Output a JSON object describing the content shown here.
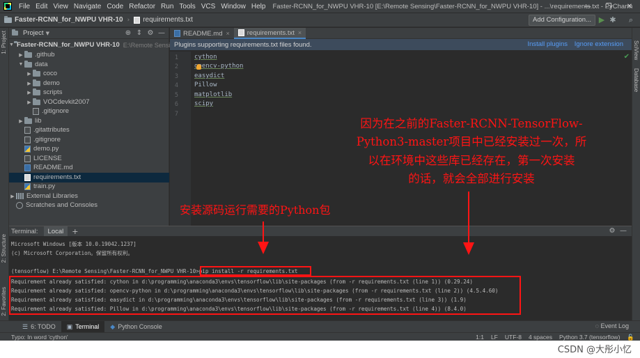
{
  "menubar": {
    "items": [
      "File",
      "Edit",
      "View",
      "Navigate",
      "Code",
      "Refactor",
      "Run",
      "Tools",
      "VCS",
      "Window",
      "Help"
    ],
    "window_title": "Faster-RCNN_for_NWPU VHR-10 [E:\\Remote Sensing\\Faster-RCNN_for_NWPU VHR-10] - ...\\requirements.txt - PyCharm",
    "controls": [
      "—",
      "❐",
      "✕"
    ]
  },
  "navbar": {
    "project": "Faster-RCNN_for_NWPU VHR-10",
    "file": "requirements.txt",
    "add_configuration": "Add Configuration..."
  },
  "left_stripe": {
    "project_tab": "1: Project",
    "structure_tab": "2: Structure",
    "favorites_tab": "2: Favorites"
  },
  "right_stripe": {
    "sciview_tab": "SciView",
    "database_tab": "Database"
  },
  "project_panel": {
    "title": "Project",
    "root": {
      "name": "Faster-RCNN_for_NWPU VHR-10",
      "path": "E:\\Remote Sensi"
    },
    "nodes": [
      {
        "label": ".github"
      },
      {
        "label": "data"
      },
      {
        "label": "coco"
      },
      {
        "label": "demo"
      },
      {
        "label": "scripts"
      },
      {
        "label": "VOCdevkit2007"
      },
      {
        "label": ".gitignore"
      },
      {
        "label": "lib"
      },
      {
        "label": ".gitattributes"
      },
      {
        "label": ".gitignore"
      },
      {
        "label": "demo.py"
      },
      {
        "label": "LICENSE"
      },
      {
        "label": "README.md"
      },
      {
        "label": "requirements.txt"
      },
      {
        "label": "train.py"
      },
      {
        "label": "External Libraries"
      },
      {
        "label": "Scratches and Consoles"
      }
    ]
  },
  "editor": {
    "tabs": [
      {
        "label": "README.md",
        "close": "×"
      },
      {
        "label": "requirements.txt",
        "close": "×"
      }
    ],
    "banner": {
      "message": "Plugins supporting requirements.txt files found.",
      "install": "Install plugins",
      "ignore": "Ignore extension"
    },
    "line_numbers": [
      "1",
      "2",
      "3",
      "4",
      "5",
      "6",
      "7"
    ],
    "lines": [
      "cython",
      "opencv-python",
      "easydict",
      "Pillow",
      "matplotlib",
      "scipy",
      ""
    ]
  },
  "terminal": {
    "label": "Terminal:",
    "tab": "Local",
    "add": "+",
    "lines": [
      "Microsoft Windows [版本 10.0.19042.1237]",
      "(c) Microsoft Corporation。保留所有权利。",
      "",
      "(tensorflow) E:\\Remote Sensing\\Faster-RCNN_for_NWPU VHR-10>pip install -r requirements.txt",
      "Requirement already satisfied: cython in d:\\programming\\anaconda3\\envs\\tensorflow\\lib\\site-packages (from -r requirements.txt (line 1)) (0.29.24)",
      "Requirement already satisfied: opencv-python in d:\\programming\\anaconda3\\envs\\tensorflow\\lib\\site-packages (from -r requirements.txt (line 2)) (4.5.4.60)",
      "Requirement already satisfied: easydict in d:\\programming\\anaconda3\\envs\\tensorflow\\lib\\site-packages (from -r requirements.txt (line 3)) (1.9)",
      "Requirement already satisfied: Pillow in d:\\programming\\anaconda3\\envs\\tensorflow\\lib\\site-packages (from -r requirements.txt (line 4)) (8.4.0)"
    ]
  },
  "bottom_tabs": [
    {
      "label": "6: TODO"
    },
    {
      "label": "Terminal"
    },
    {
      "label": "Python Console"
    }
  ],
  "event_log": "Event Log",
  "status": {
    "message": "Typo: In word 'cython'",
    "position": "1:1",
    "line_sep": "LF",
    "encoding": "UTF-8",
    "indent": "4 spaces",
    "interpreter": "Python 3.7 (tensorflow)"
  },
  "annotations": {
    "install_note": "安装源码运行需要的Python包",
    "explanation_lines": [
      "因为在之前的Faster-RCNN-TensorFlow-",
      "Python3-master项目中已经安装过一次，所",
      "以在环境中这些库已经存在，第一次安装",
      "的话，就会全部进行安装"
    ]
  },
  "watermark": "CSDN @大彤小忆",
  "colors": {
    "annotation_red": "#ff1414",
    "accent_blue": "#589df6",
    "selection": "#0d293e"
  }
}
